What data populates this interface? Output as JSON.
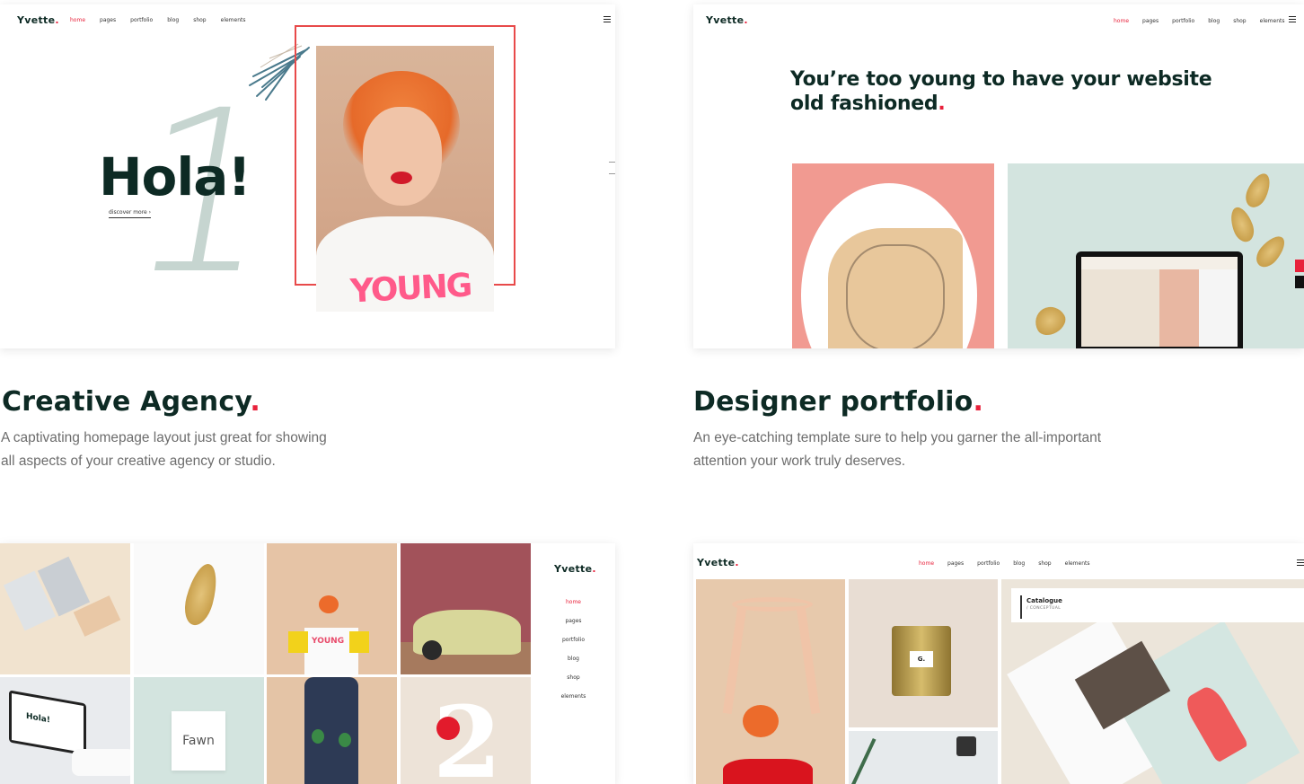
{
  "brand": {
    "name": "Yvette",
    "dot": ".",
    "accent": "#e8213b",
    "dark": "#0d2a24"
  },
  "nav": {
    "items": [
      "home",
      "pages",
      "portfolio",
      "blog",
      "shop",
      "elements"
    ]
  },
  "demos": [
    {
      "title": "Creative Agency",
      "description_line1": "A captivating homepage layout just great for showing",
      "description_line2": "all aspects of your creative agency or studio.",
      "preview": {
        "hero": "Hola!",
        "discover": "discover more  ›",
        "shirt_text": "YOUNG"
      }
    },
    {
      "title": "Designer portfolio",
      "description_line1": "An eye-catching template sure to help you garner the all-important",
      "description_line2": "attention your work truly deserves.",
      "preview": {
        "headline_line1": "You’re too young to have your website",
        "headline_line2": "old fashioned"
      }
    },
    {
      "preview": {
        "fawn": "Fawn",
        "shirt_text": "YOUNG",
        "laptop_text": "Hola!"
      }
    },
    {
      "preview": {
        "catalogue_title": "Catalogue",
        "catalogue_sub": "/ CONCEPTUAL",
        "tin_label": "G."
      }
    }
  ]
}
